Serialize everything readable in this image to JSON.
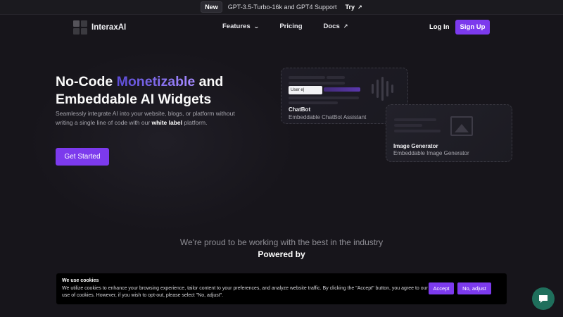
{
  "announcement": {
    "badge": "New",
    "text": "GPT-3.5-Turbo-16k and GPT4 Support",
    "link": "Try",
    "link_icon": "arrow-up-right-icon"
  },
  "nav": {
    "logo_text": "InteraxAI",
    "links": [
      {
        "label": "Features",
        "icon": "chevron-down-icon"
      },
      {
        "label": "Pricing"
      },
      {
        "label": "Docs",
        "icon": "arrow-up-right-icon"
      }
    ],
    "login": "Log In",
    "signup": "Sign Up"
  },
  "hero": {
    "title_part1": "No-Code ",
    "title_accent": "Monetizable",
    "title_part2": " and Embeddable AI Widgets",
    "subtitle_part1": "Seamlessly integrate AI into your website, blogs, or platform without writing a single line of code with our ",
    "subtitle_bold": "white label",
    "subtitle_part2": " platform.",
    "cta": "Get Started"
  },
  "widgets": {
    "chatbot": {
      "title": "ChatBot",
      "description": "Embeddable ChatBot Assistant",
      "input_text": "User e|"
    },
    "image": {
      "title": "Image Generator",
      "description": "Embeddable Image Generator"
    }
  },
  "industry": {
    "tagline": "We're proud to be working with the best in the industry",
    "powered_by": "Powered by"
  },
  "cookie": {
    "title": "We use cookies",
    "text": "We utilize cookies to enhance your browsing experience, tailor content to your preferences, and analyze website traffic. By clicking the \"Accept\" button, you agree to our use of cookies. However, if you wish to opt-out, please select \"No, adjust\".",
    "accept": "Accept",
    "reject": "No, adjust"
  },
  "colors": {
    "accent": "#7c3aed",
    "background": "#17151b",
    "chat_fab": "#1f6f5c"
  }
}
